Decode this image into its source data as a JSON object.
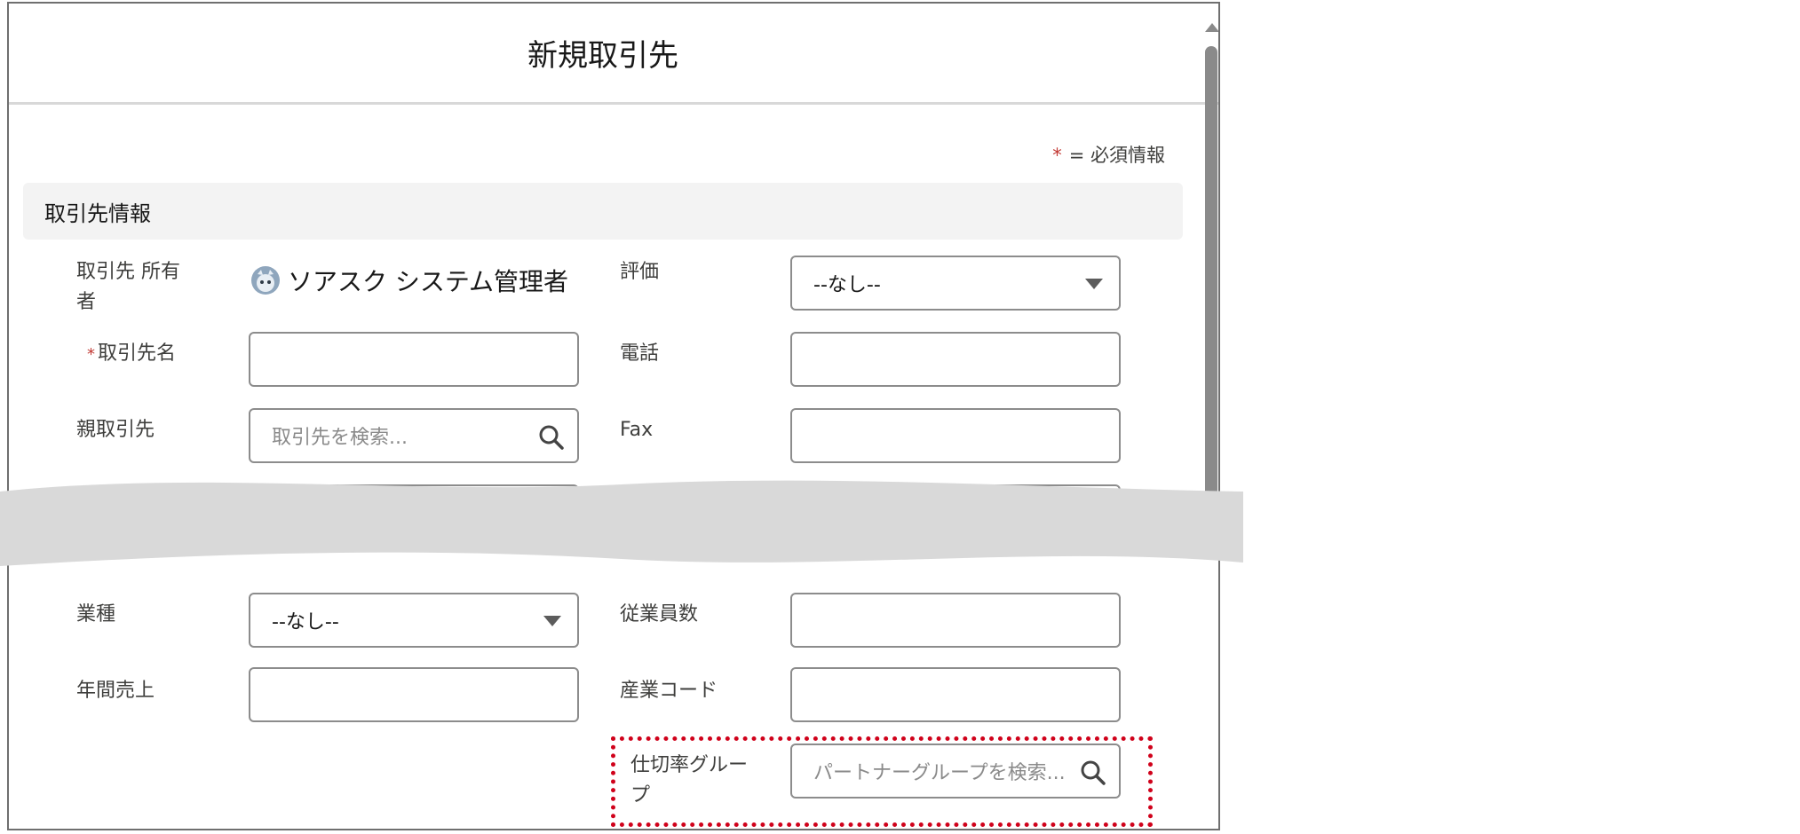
{
  "modal": {
    "title": "新規取引先",
    "required_legend_star": "*",
    "required_legend_text": "= 必須情報",
    "section_title": "取引先情報"
  },
  "fields": {
    "owner_label": "取引先 所有者",
    "owner_value": "ソアスク システム管理者",
    "rating_label": "評価",
    "rating_value": "--なし--",
    "name_required": "*",
    "name_label": "取引先名",
    "name_value": "",
    "phone_label": "電話",
    "phone_value": "",
    "parent_label": "親取引先",
    "parent_placeholder": "取引先を検索...",
    "fax_label": "Fax",
    "fax_value": "",
    "industry_label": "業種",
    "industry_value": "--なし--",
    "employees_label": "従業員数",
    "employees_value": "",
    "revenue_label": "年間売上",
    "revenue_value": "",
    "industry_code_label": "産業コード",
    "industry_code_value": "",
    "partner_group_label": "仕切率グループ",
    "partner_group_placeholder": "パートナーグループを検索..."
  },
  "icons": {
    "owner_avatar": "avatar-icon",
    "search": "search-icon",
    "dropdown": "chevron-down-icon"
  },
  "colors": {
    "required": "#c23934",
    "highlight": "#d0021b",
    "section_bg": "#f3f3f3"
  }
}
